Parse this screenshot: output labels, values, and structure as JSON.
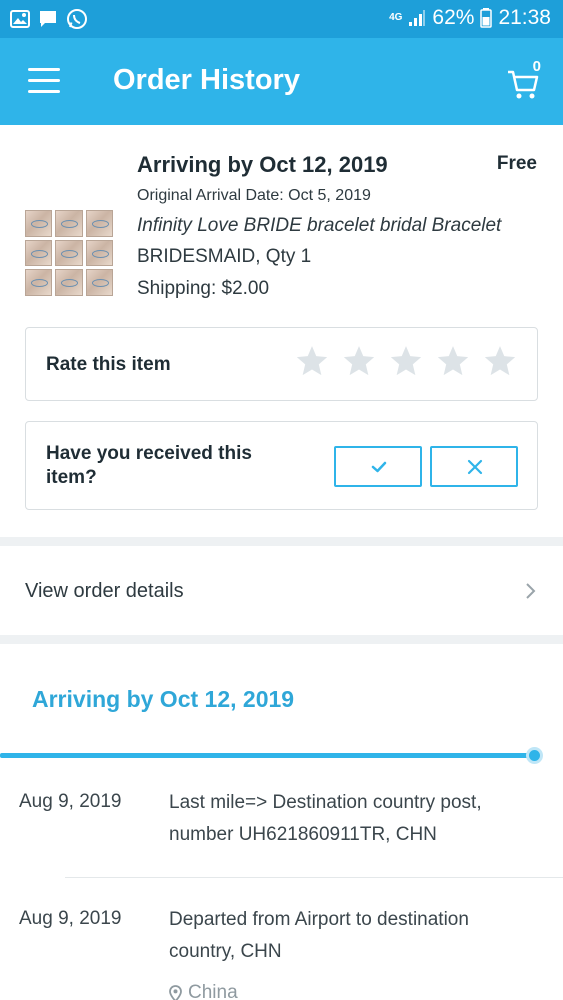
{
  "status_bar": {
    "network": "4G",
    "battery": "62%",
    "time": "21:38",
    "icons": [
      "gallery-icon",
      "message-icon",
      "whatsapp-icon"
    ]
  },
  "app_bar": {
    "title": "Order History",
    "cart_count": "0"
  },
  "order_item": {
    "arrival_title": "Arriving by Oct 12, 2019",
    "price": "Free",
    "original_arrival": "Original Arrival Date: Oct 5, 2019",
    "product_name": "Infinity Love BRIDE bracelet bridal Bracelet",
    "variant": "BRIDESMAID, Qty 1",
    "shipping": "Shipping: $2.00"
  },
  "rate": {
    "label": "Rate this item",
    "rating": 0,
    "max": 5
  },
  "received": {
    "label": "Have you received this item?"
  },
  "view_order": {
    "label": "View order details"
  },
  "tracking": {
    "heading": "Arriving by Oct 12, 2019",
    "progress": 0.96,
    "events": [
      {
        "date": "Aug 9, 2019",
        "description": "Last mile=> Destination country post, number UH621860911TR, CHN"
      },
      {
        "date": "Aug 9, 2019",
        "description": "Departed from Airport to destination country, CHN",
        "location": "China"
      }
    ]
  },
  "colors": {
    "status_bar": "#1e9fd9",
    "app_bar": "#2fb4e9",
    "accent": "#2fa7d8",
    "star_empty": "#dde3e7"
  }
}
